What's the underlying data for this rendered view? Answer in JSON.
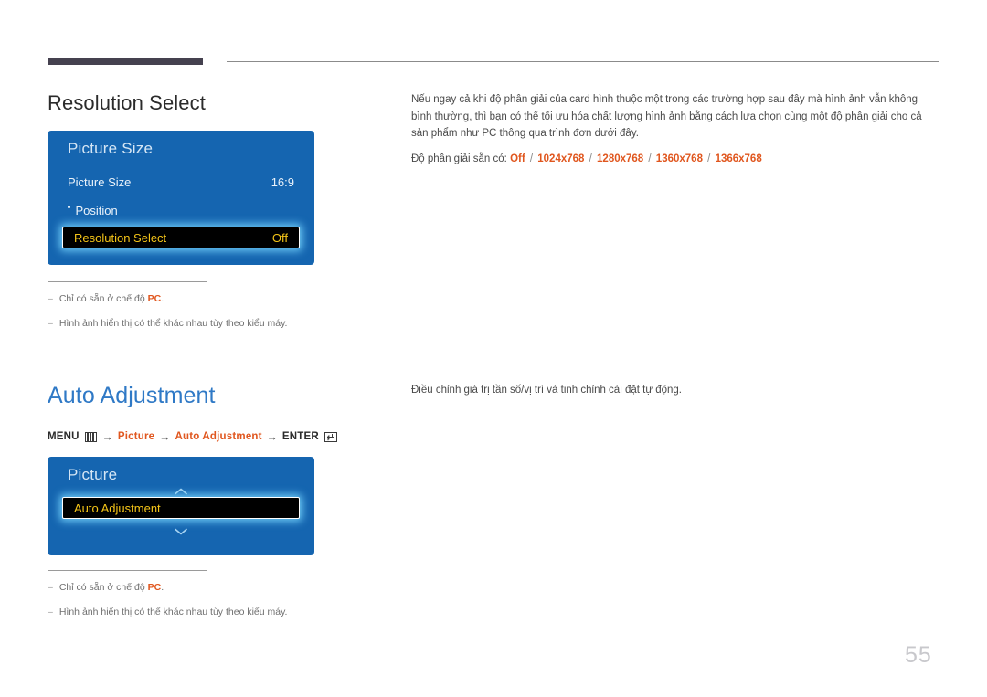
{
  "page": {
    "number": "55"
  },
  "sections": {
    "resolution_select": {
      "heading": "Resolution Select",
      "osd": {
        "title": "Picture Size",
        "rows": [
          {
            "label": "Picture Size",
            "value": "16:9"
          },
          {
            "label": "Position",
            "value": ""
          }
        ],
        "selected_row": {
          "label": "Resolution Select",
          "value": "Off"
        }
      },
      "body": {
        "paragraph": "Nếu ngay cả khi độ phân giải của card hình thuộc một trong các trường hợp sau đây mà hình ảnh vẫn không bình thường, thì bạn có thể tối ưu hóa chất lượng hình ảnh bằng cách lựa chọn cùng một độ phân giải cho cả sản phẩm như PC thông qua trình đơn dưới đây.",
        "resolutions_label": "Độ phân giải sẵn có:",
        "resolutions": [
          "Off",
          "1024x768",
          "1280x768",
          "1360x768",
          "1366x768"
        ],
        "separator": "/"
      },
      "notes": [
        {
          "dash": "‒",
          "text_before": "Chỉ có sẵn ở chế độ ",
          "highlight": "PC",
          "text_after": "."
        },
        {
          "dash": "‒",
          "text_before": "Hình ảnh hiển thị có thể khác nhau tùy theo kiểu máy.",
          "highlight": "",
          "text_after": ""
        }
      ]
    },
    "auto_adjustment": {
      "heading": "Auto Adjustment",
      "breadcrumb": {
        "menu_label": "MENU",
        "menu_icon": "menu-icon",
        "arrow": "→",
        "crumb1": "Picture",
        "crumb2": "Auto Adjustment",
        "enter_label": "ENTER",
        "enter_icon": "enter-icon"
      },
      "osd": {
        "title": "Picture",
        "chevron_up": "chevron-up-icon",
        "chevron_down": "chevron-down-icon",
        "selected_row": {
          "label": "Auto Adjustment",
          "value": ""
        }
      },
      "body": {
        "paragraph": "Điều chỉnh giá trị tần số/vị trí và tinh chỉnh cài đặt tự động."
      },
      "notes": [
        {
          "dash": "‒",
          "text_before": "Chỉ có sẵn ở chế độ ",
          "highlight": "PC",
          "text_after": "."
        },
        {
          "dash": "‒",
          "text_before": "Hình ảnh hiển thị có thể khác nhau tùy theo kiểu máy.",
          "highlight": "",
          "text_after": ""
        }
      ]
    }
  },
  "colors": {
    "osd_blue": "#1565b0",
    "accent_orange": "#e0561e",
    "heading_blue": "#2f79c6",
    "highlight_yellow": "#f5c518",
    "glow_cyan": "#78d7ff"
  }
}
